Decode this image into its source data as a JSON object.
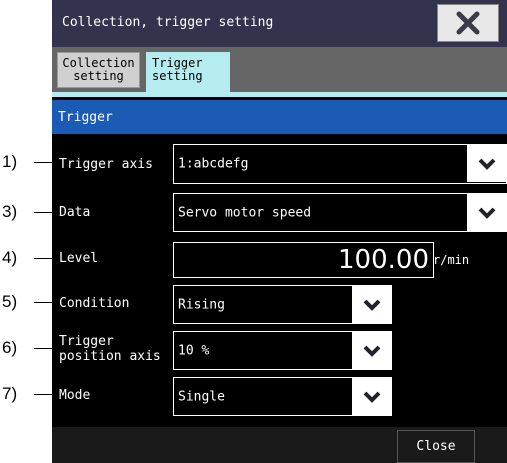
{
  "window": {
    "title": "Collection, trigger setting"
  },
  "tabs": [
    {
      "label": "Collection\nsetting",
      "active": false
    },
    {
      "label": "Trigger\nsetting",
      "active": true
    }
  ],
  "section": {
    "title": "Trigger"
  },
  "callouts": [
    "1)",
    "3)",
    "4)",
    "5)",
    "6)",
    "7)"
  ],
  "fields": {
    "trigger_axis": {
      "label": "Trigger axis",
      "value": "1:abcdefg"
    },
    "data": {
      "label": "Data",
      "value": "Servo motor speed"
    },
    "level": {
      "label": "Level",
      "value": "100.00",
      "unit": "r/min"
    },
    "condition": {
      "label": "Condition",
      "value": "Rising"
    },
    "trigger_position_axis": {
      "label": "Trigger\nposition axis",
      "value": "10 %"
    },
    "mode": {
      "label": "Mode",
      "value": "Single"
    }
  },
  "footer": {
    "close_label": "Close"
  },
  "colors": {
    "titlebar": "#33334e",
    "active_tab": "#b5ecf0",
    "section_header": "#1b5ab5",
    "background": "#000000"
  },
  "icons": {
    "close": "close-x-icon",
    "dropdown": "chevron-down-icon"
  }
}
